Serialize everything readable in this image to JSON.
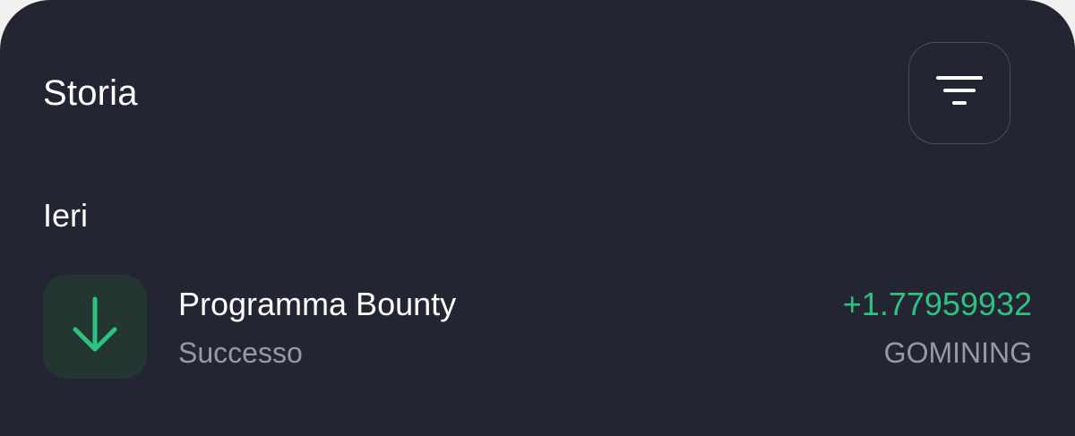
{
  "header": {
    "title": "Storia",
    "filter_icon": "filter-icon"
  },
  "sections": [
    {
      "label": "Ieri",
      "transactions": [
        {
          "icon": "arrow-down-icon",
          "name": "Programma Bounty",
          "status": "Successo",
          "amount": "+1.77959932",
          "currency": "GOMINING"
        }
      ]
    }
  ],
  "colors": {
    "background": "#232532",
    "positive": "#2ec27e",
    "muted_text": "#9699ab",
    "icon_tile": "#233632"
  }
}
